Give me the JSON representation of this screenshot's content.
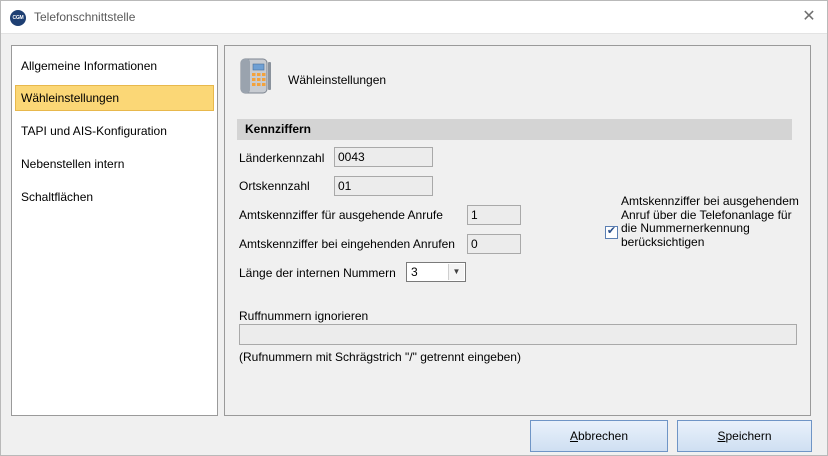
{
  "window": {
    "title": "Telefonschnittstelle",
    "app_icon_text": "CGM"
  },
  "nav": {
    "items": [
      {
        "label": "Allgemeine Informationen",
        "selected": false
      },
      {
        "label": "Wähleinstellungen",
        "selected": true
      },
      {
        "label": "TAPI und AIS-Konfiguration",
        "selected": false
      },
      {
        "label": "Nebenstellen intern",
        "selected": false
      },
      {
        "label": "Schaltflächen",
        "selected": false
      }
    ]
  },
  "content": {
    "header_title": "Wähleinstellungen",
    "section_title": "Kennziffern",
    "country_code": {
      "label": "Länderkennzahl",
      "value": "0043"
    },
    "area_code": {
      "label": "Ortskennzahl",
      "value": "01"
    },
    "outgoing_prefix": {
      "label": "Amtskennziffer für ausgehende Anrufe",
      "value": "1"
    },
    "incoming_prefix": {
      "label": "Amtskennziffer bei eingehenden Anrufen",
      "value": "0"
    },
    "internal_length": {
      "label": "Länge der internen Nummern",
      "value": "3"
    },
    "consider_prefix_checkbox": {
      "label": "Amtskennziffer bei ausgehendem Anruf über die Telefonanlage  für die Nummernerkennung berücksichtigen",
      "checked": true
    },
    "ignore_numbers": {
      "label": "Ruffnummern ignorieren",
      "value": "",
      "hint": "(Rufnummern mit Schrägstrich \"/\" getrennt eingeben)"
    }
  },
  "buttons": {
    "cancel_mnemonic": "A",
    "cancel_rest": "bbrechen",
    "save_mnemonic": "S",
    "save_rest": "peichern"
  },
  "colors": {
    "selection": "#fbd776",
    "section_bar": "#d4d4d4",
    "button_border": "#6f95c6"
  }
}
